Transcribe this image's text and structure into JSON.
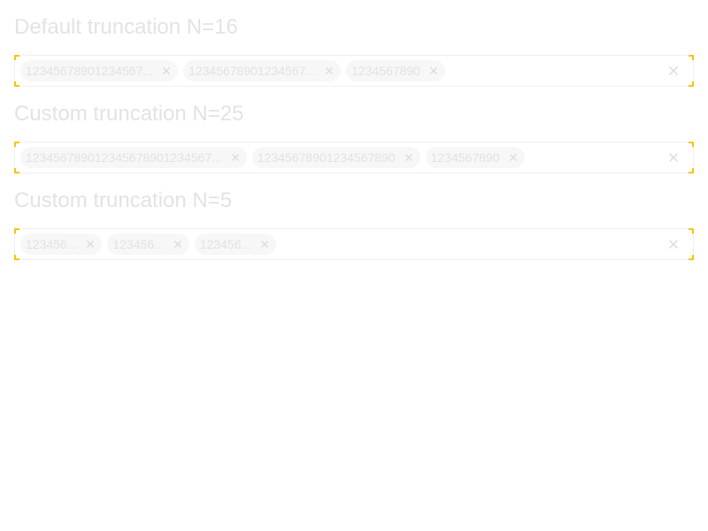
{
  "sections": [
    {
      "title": "Default truncation N=16",
      "chips": [
        {
          "label": "12345678901234567..."
        },
        {
          "label": "12345678901234567..."
        },
        {
          "label": "1234567890"
        }
      ]
    },
    {
      "title": "Custom truncation N=25",
      "chips": [
        {
          "label": "12345678901234567890123456​7..."
        },
        {
          "label": "12345678901234567890"
        },
        {
          "label": "1234567890"
        }
      ]
    },
    {
      "title": "Custom truncation N=5",
      "chips": [
        {
          "label": "123456..."
        },
        {
          "label": "123456..."
        },
        {
          "label": "123456..."
        }
      ]
    }
  ],
  "icons": {
    "chip_remove": "close-icon",
    "clear_all": "close-icon"
  },
  "colors": {
    "text": "#e2e2e2",
    "chip_bg": "#f7f7f7",
    "focus_corner": "#f7c600"
  }
}
